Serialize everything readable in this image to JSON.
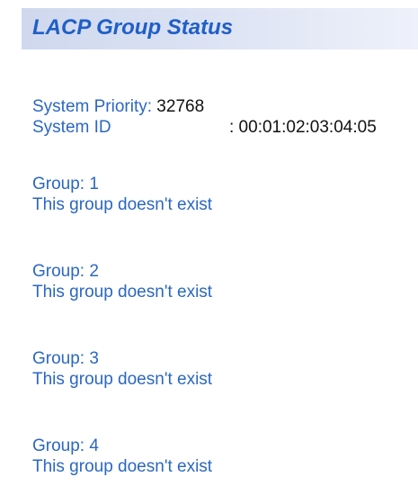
{
  "header": {
    "title": "LACP Group Status"
  },
  "system": {
    "priority_label": "System Priority:",
    "priority_value": " 32768",
    "id_label": "System ID",
    "id_value": ": 00:01:02:03:04:05"
  },
  "groups": [
    {
      "label": "Group: 1",
      "status": "This group doesn't exist"
    },
    {
      "label": "Group: 2",
      "status": "This group doesn't exist"
    },
    {
      "label": "Group: 3",
      "status": "This group doesn't exist"
    },
    {
      "label": "Group: 4",
      "status": "This group doesn't exist"
    }
  ],
  "colors": {
    "label_blue": "#2b67c2",
    "title_blue": "#1f5fc7",
    "value_black": "#111111",
    "title_bar_bg": "#dbe2f3"
  }
}
